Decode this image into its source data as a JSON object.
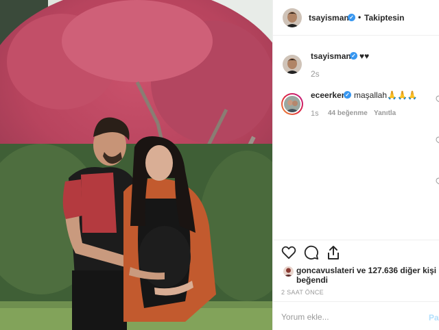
{
  "header": {
    "username": "tsayisman",
    "separator": "•",
    "follow_status": "Takiptesin"
  },
  "caption": {
    "username": "tsayisman",
    "text": "♥♥",
    "time": "2s"
  },
  "comments": [
    {
      "username": "eceerken",
      "text": "maşallah🙏🙏🙏",
      "time": "1s",
      "likes": "44 beğenme",
      "reply_label": "Yanıtla"
    }
  ],
  "likes": {
    "first_user": "goncavuslateri",
    "rest": "ve 127.636 diğer kişi",
    "suffix": "beğendi"
  },
  "timestamp": "2 SAAT ÖNCE",
  "comment_input": {
    "placeholder": "Yorum ekle...",
    "post_label": "Pay"
  },
  "icons": {
    "like": "heart-icon",
    "comment": "comment-icon",
    "share": "share-icon",
    "verified": "verified-badge-icon"
  },
  "colors": {
    "verified": "#3897f0",
    "post_button": "#b2dffc",
    "secondary_text": "#999999"
  }
}
